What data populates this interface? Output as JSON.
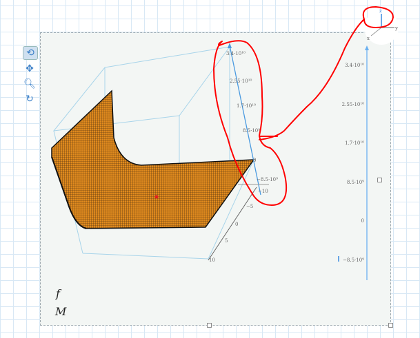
{
  "toolbar": {
    "tools": [
      "rotate-icon",
      "pan-icon",
      "zoom-icon",
      "reset-icon"
    ]
  },
  "plot": {
    "axis_labels": {
      "x": "x",
      "y": "y",
      "z": "z"
    },
    "z_ticks_3d": [
      "3.4·10¹⁰",
      "2.55·10¹⁰",
      "1.7·10¹⁰",
      "8.5·10⁹",
      "0",
      "−8.5·10⁹"
    ],
    "x_ticks_3d": [
      "−10",
      "−5",
      "0",
      "5",
      "10"
    ],
    "z_ticks_right": [
      "3.4·10¹⁰",
      "2.55·10¹⁰",
      "1.7·10¹⁰",
      "8.5·10⁹",
      "0",
      "−8.5·10⁹"
    ],
    "surface_color": "#e08a1e",
    "annotation_color": "#ff0000"
  },
  "labels": {
    "function": "f",
    "variable": "M"
  }
}
